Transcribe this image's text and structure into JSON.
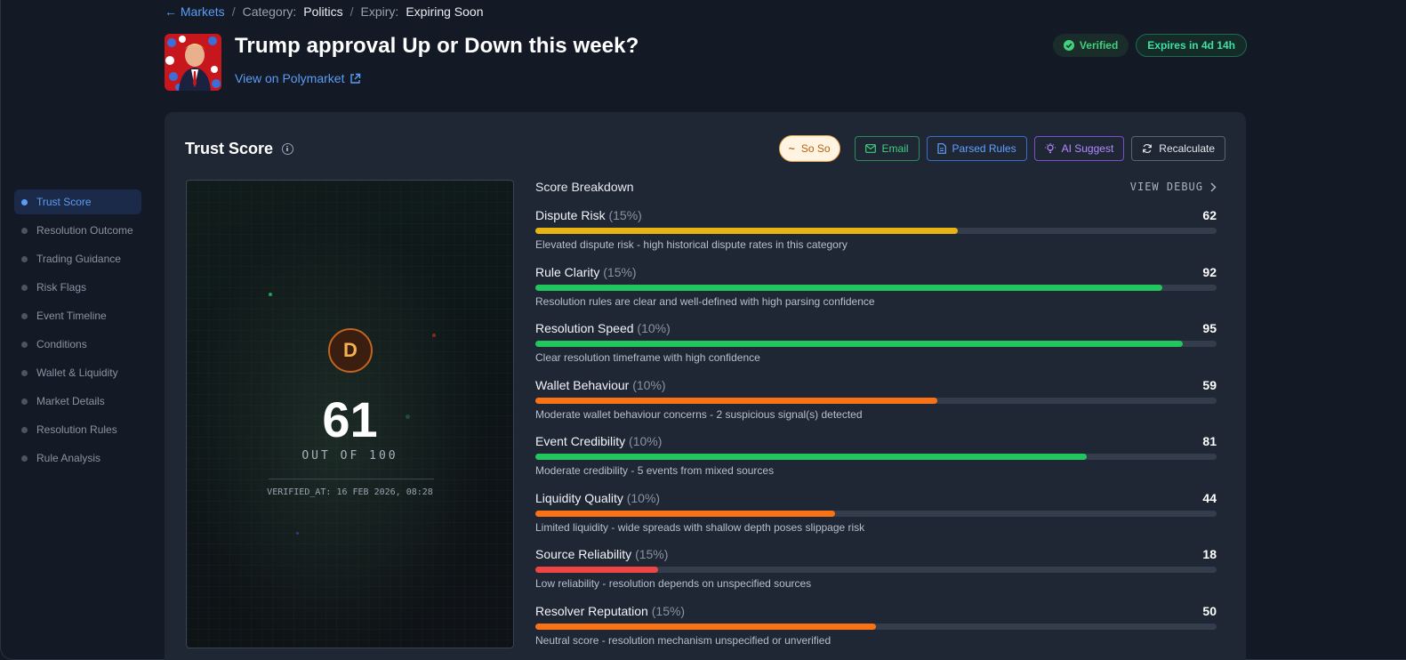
{
  "breadcrumb": {
    "back_label": "← Markets",
    "category_key": "Category:",
    "category_value": "Politics",
    "expiry_key": "Expiry:",
    "expiry_value": "Expiring Soon",
    "separator": "/"
  },
  "header": {
    "title": "Trump approval Up or Down this week?",
    "polymarket_link": "View on Polymarket",
    "badge_verified": "Verified",
    "badge_expires": "Expires in 4d 14h"
  },
  "sidebar": {
    "items": [
      {
        "label": "Trust Score",
        "active": true
      },
      {
        "label": "Resolution Outcome",
        "active": false
      },
      {
        "label": "Trading Guidance",
        "active": false
      },
      {
        "label": "Risk Flags",
        "active": false
      },
      {
        "label": "Event Timeline",
        "active": false
      },
      {
        "label": "Conditions",
        "active": false
      },
      {
        "label": "Wallet & Liquidity",
        "active": false
      },
      {
        "label": "Market Details",
        "active": false
      },
      {
        "label": "Resolution Rules",
        "active": false
      },
      {
        "label": "Rule Analysis",
        "active": false
      }
    ]
  },
  "trust": {
    "title": "Trust Score",
    "rating_pill": "So So",
    "rating_icon": "~",
    "buttons": {
      "email": "Email",
      "parsed_rules": "Parsed Rules",
      "ai_suggest": "AI Suggest",
      "recalculate": "Recalculate"
    },
    "grade": "D",
    "score": "61",
    "out_of": "OUT OF 100",
    "verified_at": "VERIFIED_AT: 16 FEB 2026, 08:28"
  },
  "breakdown": {
    "title": "Score Breakdown",
    "debug_label": "VIEW DEBUG",
    "items": [
      {
        "name": "Dispute Risk",
        "weight": "(15%)",
        "value": 62,
        "color": "#e7b416",
        "desc": "Elevated dispute risk - high historical dispute rates in this category"
      },
      {
        "name": "Rule Clarity",
        "weight": "(15%)",
        "value": 92,
        "color": "#22c55e",
        "desc": "Resolution rules are clear and well-defined with high parsing confidence"
      },
      {
        "name": "Resolution Speed",
        "weight": "(10%)",
        "value": 95,
        "color": "#22c55e",
        "desc": "Clear resolution timeframe with high confidence"
      },
      {
        "name": "Wallet Behaviour",
        "weight": "(10%)",
        "value": 59,
        "color": "#f97316",
        "desc": "Moderate wallet behaviour concerns - 2 suspicious signal(s) detected"
      },
      {
        "name": "Event Credibility",
        "weight": "(10%)",
        "value": 81,
        "color": "#22c55e",
        "desc": "Moderate credibility - 5 events from mixed sources"
      },
      {
        "name": "Liquidity Quality",
        "weight": "(10%)",
        "value": 44,
        "color": "#f97316",
        "desc": "Limited liquidity - wide spreads with shallow depth poses slippage risk"
      },
      {
        "name": "Source Reliability",
        "weight": "(15%)",
        "value": 18,
        "color": "#ef4444",
        "desc": "Low reliability - resolution depends on unspecified sources"
      },
      {
        "name": "Resolver Reputation",
        "weight": "(15%)",
        "value": 50,
        "color": "#f97316",
        "desc": "Neutral score - resolution mechanism unspecified or unverified"
      }
    ]
  }
}
